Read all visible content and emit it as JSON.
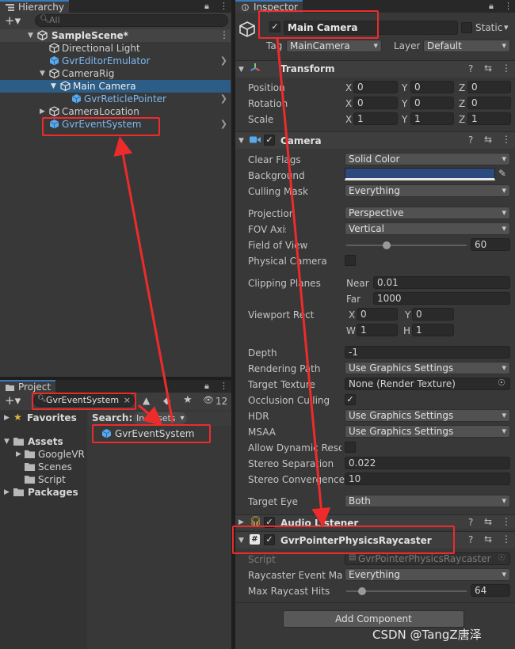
{
  "hierarchy": {
    "tab": "Hierarchy",
    "search_placeholder": "All",
    "add_label": "+▾",
    "items": [
      {
        "label": "SampleScene*",
        "type": "scene"
      },
      {
        "label": "Directional Light",
        "type": "object"
      },
      {
        "label": "GvrEditorEmulator",
        "type": "prefab"
      },
      {
        "label": "CameraRig",
        "type": "object"
      },
      {
        "label": "Main Camera",
        "type": "object"
      },
      {
        "label": "GvrReticlePointer",
        "type": "prefab"
      },
      {
        "label": "CameraLocation",
        "type": "object"
      },
      {
        "label": "GvrEventSystem",
        "type": "prefab"
      }
    ]
  },
  "project": {
    "tab": "Project",
    "add_label": "+▾",
    "search_value": "GvrEventSystem",
    "hidden_count": "12",
    "search_label": "Search:",
    "search_scope": "In Assets",
    "result": "GvrEventSystem",
    "tree": [
      {
        "label": "Favorites"
      },
      {
        "label": "Assets"
      },
      {
        "label": "GoogleVR"
      },
      {
        "label": "Scenes"
      },
      {
        "label": "Script"
      },
      {
        "label": "Packages"
      }
    ]
  },
  "inspector": {
    "tab": "Inspector",
    "object_name": "Main Camera",
    "static_label": "Static",
    "tag_label": "Tag",
    "tag_value": "MainCamera",
    "layer_label": "Layer",
    "layer_value": "Default",
    "transform": {
      "title": "Transform",
      "position_label": "Position",
      "rotation_label": "Rotation",
      "scale_label": "Scale",
      "position": [
        "0",
        "0",
        "0"
      ],
      "rotation": [
        "0",
        "0",
        "0"
      ],
      "scale": [
        "1",
        "1",
        "1"
      ]
    },
    "axes": [
      "X",
      "Y",
      "Z"
    ],
    "camera": {
      "title": "Camera",
      "clear_flags_label": "Clear Flags",
      "clear_flags": "Solid Color",
      "background_label": "Background",
      "background_color": "#2c4a7e",
      "culling_mask_label": "Culling Mask",
      "culling_mask": "Everything",
      "projection_label": "Projection",
      "projection": "Perspective",
      "fov_axis_label": "FOV Axis",
      "fov_axis": "Vertical",
      "fov_label": "Field of View",
      "fov": "60",
      "physical_label": "Physical Camera",
      "clipping_label": "Clipping Planes",
      "near_label": "Near",
      "near": "0.01",
      "far_label": "Far",
      "far": "1000",
      "viewport_label": "Viewport Rect",
      "vx": "0",
      "vy": "0",
      "vw": "1",
      "vh": "1",
      "w_label": "W",
      "h_label": "H",
      "depth_label": "Depth",
      "depth": "-1",
      "render_path_label": "Rendering Path",
      "render_path": "Use Graphics Settings",
      "target_texture_label": "Target Texture",
      "target_texture": "None (Render Texture)",
      "occlusion_label": "Occlusion Culling",
      "hdr_label": "HDR",
      "hdr": "Use Graphics Settings",
      "msaa_label": "MSAA",
      "msaa": "Use Graphics Settings",
      "dynamic_res_label": "Allow Dynamic Resolution",
      "stereo_sep_label": "Stereo Separation",
      "stereo_sep": "0.022",
      "stereo_conv_label": "Stereo Convergence",
      "stereo_conv": "10",
      "target_eye_label": "Target Eye",
      "target_eye": "Both"
    },
    "audio_listener": {
      "title": "Audio Listener"
    },
    "raycaster": {
      "title": "GvrPointerPhysicsRaycaster",
      "script_label": "Script",
      "script_value": "GvrPointerPhysicsRaycaster",
      "event_mask_label": "Raycaster Event Mask",
      "event_mask": "Everything",
      "max_hits_label": "Max Raycast Hits",
      "max_hits": "64"
    },
    "add_component": "Add Component"
  },
  "watermark": "CSDN @TangZ唐泽",
  "colors": {
    "selection": "#2c5d87",
    "accent": "#3a79bb",
    "annotation": "#ee2b2b",
    "prefab_text": "#7cb9f2"
  }
}
